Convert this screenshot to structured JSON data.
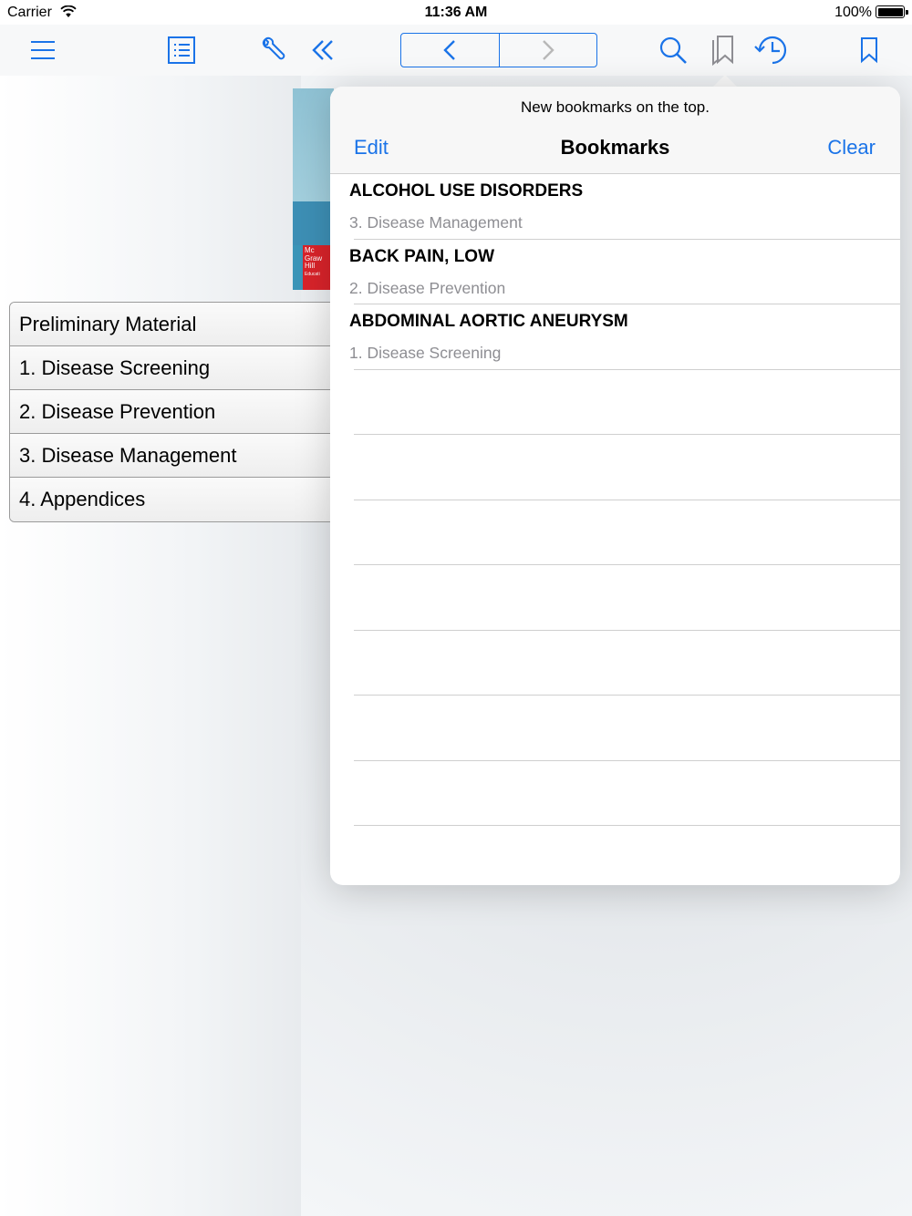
{
  "status_bar": {
    "carrier": "Carrier",
    "time": "11:36 AM",
    "battery": "100%"
  },
  "toolbar": {
    "icons": [
      "menu-icon",
      "table-of-contents-icon",
      "wrench-icon",
      "double-chevron-left-icon",
      "chevron-left-icon",
      "chevron-right-icon",
      "search-icon",
      "bookmarks-icon",
      "history-icon",
      "bookmark-icon"
    ],
    "accent_color": "#1a73e8",
    "disabled_color": "#b8b8b8"
  },
  "cover": {
    "logo_lines": [
      "Mc",
      "Graw",
      "Hill",
      "Educati"
    ]
  },
  "toc": {
    "items": [
      {
        "label": "Preliminary Material"
      },
      {
        "label": "1. Disease Screening"
      },
      {
        "label": "2. Disease Prevention"
      },
      {
        "label": "3. Disease Management"
      },
      {
        "label": "4. Appendices"
      }
    ]
  },
  "bookmarks_popover": {
    "hint": "New bookmarks on the top.",
    "edit_label": "Edit",
    "title": "Bookmarks",
    "clear_label": "Clear",
    "items": [
      {
        "title": "ALCOHOL USE DISORDERS",
        "section": "3. Disease Management"
      },
      {
        "title": "BACK PAIN, LOW",
        "section": "2. Disease Prevention"
      },
      {
        "title": "ABDOMINAL AORTIC ANEURYSM",
        "section": "1. Disease Screening"
      }
    ]
  }
}
